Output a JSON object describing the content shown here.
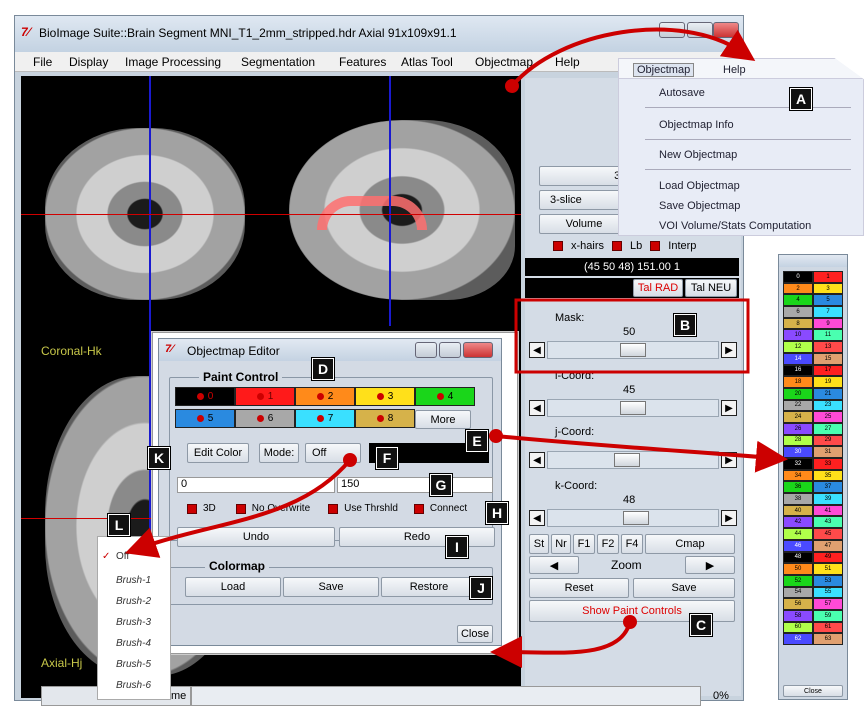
{
  "window": {
    "title": "BioImage Suite::Brain Segment MNI_T1_2mm_stripped.hdr Axial 91x109x91.1",
    "icon": "7⁄"
  },
  "menubar": {
    "items": [
      "File",
      "Display",
      "Image Processing",
      "Segmentation",
      "Features",
      "Atlas Tool",
      "Objectmap",
      "Help"
    ]
  },
  "viewer": {
    "coronal_label": "Coronal-Hk",
    "axial_label": "Axial-Hj"
  },
  "objectmap_menu": {
    "header": [
      "Objectmap",
      "Help"
    ],
    "items": [
      "Autosave",
      "Objectmap Info",
      "New Objectmap",
      "Load Objectmap",
      "Save Objectmap",
      "VOI Volume/Stats Computation"
    ]
  },
  "right_panel": {
    "slice_mode_btn": "3-Slice M",
    "layout_select": "3-slice",
    "volume_btn": "Volume",
    "checks": [
      "x-hairs",
      "Lb",
      "Interp"
    ],
    "coord_readout": "(45 50 48) 151.00 1",
    "tal_rad": "Tal RAD",
    "tal_neu": "Tal NEU",
    "mask": {
      "label": "Mask:",
      "value": "50",
      "level": 0.5
    },
    "icoord": {
      "label": "i-Coord:",
      "value": "45",
      "level": 0.5
    },
    "jcoord": {
      "label": "j-Coord:",
      "value": "",
      "level": 0.46
    },
    "kcoord": {
      "label": "k-Coord:",
      "value": "48",
      "level": 0.52
    },
    "small_btns": [
      "St",
      "Nr",
      "F1",
      "F2",
      "F4"
    ],
    "cmap_btn": "Cmap",
    "zoom_label": "Zoom",
    "reset_btn": "Reset",
    "save_btn": "Save",
    "show_paint_btn": "Show Paint Controls"
  },
  "editor": {
    "title": "Objectmap Editor",
    "paint_control": "Paint Control",
    "colors": [
      {
        "label": "0",
        "color": "#000000",
        "text": "#d00000"
      },
      {
        "label": "1",
        "color": "#ff1a1a",
        "text": "#600"
      },
      {
        "label": "2",
        "color": "#ff8a1a",
        "text": "#000"
      },
      {
        "label": "3",
        "color": "#ffe01a",
        "text": "#000"
      },
      {
        "label": "4",
        "color": "#1ad61a",
        "text": "#000"
      },
      {
        "label": "5",
        "color": "#2a8ae0",
        "text": "#000"
      },
      {
        "label": "6",
        "color": "#a8a8a8",
        "text": "#000"
      },
      {
        "label": "7",
        "color": "#3ae0ff",
        "text": "#000"
      },
      {
        "label": "8",
        "color": "#d6b24a",
        "text": "#000"
      }
    ],
    "more_btn": "More",
    "edit_color_btn": "Edit Color",
    "mode_label": "Mode:",
    "mode_value": "Off",
    "range_min": "0",
    "range_max": "150",
    "options": [
      "3D",
      "No Overwrite",
      "Use Thrshld",
      "Connect"
    ],
    "undo_btn": "Undo",
    "redo_btn": "Redo",
    "colormap_label": "Colormap",
    "load_btn": "Load",
    "save_btn": "Save",
    "restore_btn": "Restore",
    "close_btn": "Close"
  },
  "brush_menu": {
    "items": [
      "Off",
      "Brush-1",
      "Brush-2",
      "Brush-3",
      "Brush-4",
      "Brush-5",
      "Brush-6"
    ]
  },
  "statusbar": {
    "label": "me",
    "percent": "0%"
  },
  "palette": {
    "close": "Close",
    "cells": [
      "0",
      "1",
      "2",
      "3",
      "4",
      "5",
      "6",
      "7",
      "8",
      "9",
      "10",
      "11",
      "12",
      "13",
      "14",
      "15",
      "16",
      "17",
      "18",
      "19",
      "20",
      "21",
      "22",
      "23",
      "24",
      "25",
      "26",
      "27",
      "28",
      "29",
      "30",
      "31",
      "32",
      "33",
      "34",
      "35",
      "36",
      "37",
      "38",
      "39",
      "40",
      "41",
      "42",
      "43",
      "44",
      "45",
      "46",
      "47",
      "48",
      "49",
      "50",
      "51",
      "52",
      "53",
      "54",
      "55",
      "56",
      "57",
      "58",
      "59",
      "60",
      "61",
      "62",
      "63"
    ]
  },
  "callouts": [
    "A",
    "B",
    "C",
    "D",
    "E",
    "F",
    "G",
    "H",
    "I",
    "J",
    "K",
    "L"
  ]
}
